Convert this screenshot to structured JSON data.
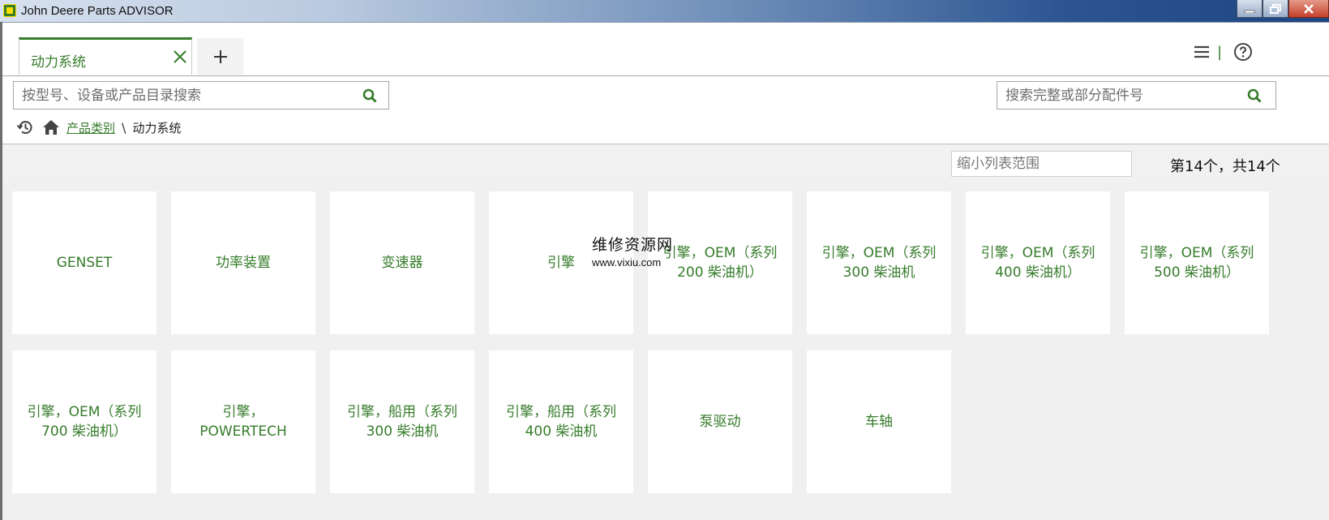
{
  "window": {
    "title": "John Deere Parts ADVISOR"
  },
  "tabs": {
    "active_label": "动力系统",
    "add_label": "+"
  },
  "search": {
    "main_placeholder": "按型号、设备或产品目录搜索",
    "part_placeholder": "搜索完整或部分配件号"
  },
  "breadcrumb": {
    "link": "产品类别",
    "separator": "\\",
    "current": "动力系统"
  },
  "filter": {
    "placeholder": "缩小列表范围",
    "count": "第14个，共14个"
  },
  "tiles": [
    "GENSET",
    "功率装置",
    "变速器",
    "引擎",
    "引擎，OEM（系列 200 柴油机）",
    "引擎，OEM（系列 300 柴油机",
    "引擎，OEM（系列 400 柴油机）",
    "引擎，OEM（系列 500 柴油机）",
    "引擎，OEM（系列 700 柴油机）",
    "引擎，POWERTECH",
    "引擎，船用（系列 300 柴油机",
    "引擎，船用（系列 400 柴油机",
    "泵驱动",
    "车轴"
  ],
  "watermark": {
    "text": "维修资源网",
    "url": "www.vixiu.com"
  },
  "colors": {
    "brand_green": "#367c2b",
    "titlebar_blue": "#2c5592",
    "grid_bg": "#f0f0f0"
  },
  "icons": {
    "tab_close": "close-icon",
    "tab_add": "plus-icon",
    "menu": "hamburger-menu-icon",
    "help": "help-icon",
    "search": "search-icon",
    "history": "history-icon",
    "home": "home-icon"
  }
}
